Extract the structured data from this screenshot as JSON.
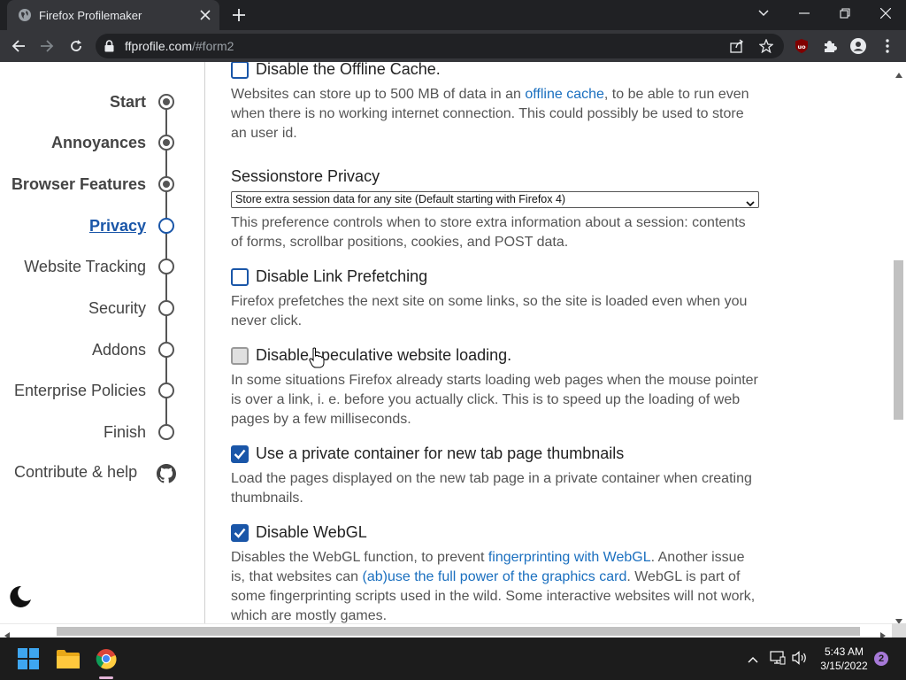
{
  "browser": {
    "tab_title": "Firefox Profilemaker",
    "url_host": "ffprofile.com",
    "url_path": "/#form2"
  },
  "sidebar": {
    "items": [
      {
        "label": "Start",
        "state": "done"
      },
      {
        "label": "Annoyances",
        "state": "done"
      },
      {
        "label": "Browser Features",
        "state": "done"
      },
      {
        "label": "Privacy",
        "state": "active"
      },
      {
        "label": "Website Tracking",
        "state": "todo"
      },
      {
        "label": "Security",
        "state": "todo"
      },
      {
        "label": "Addons",
        "state": "todo"
      },
      {
        "label": "Enterprise Policies",
        "state": "todo"
      },
      {
        "label": "Finish",
        "state": "todo"
      }
    ],
    "contribute_label": "Contribute & help"
  },
  "content": {
    "offline_cache": {
      "label": "Disable the Offline Cache.",
      "checked": false,
      "desc_before": "Websites can store up to 500 MB of data in an ",
      "desc_link": "offline cache",
      "desc_after": ", to be able to run even when there is no working internet connection. This could possibly be used to store an user id."
    },
    "sessionstore": {
      "title": "Sessionstore Privacy",
      "selected": "Store extra session data for any site (Default starting with Firefox 4)",
      "desc": "This preference controls when to store extra information about a session: contents of forms, scrollbar positions, cookies, and POST data."
    },
    "link_prefetch": {
      "label": "Disable Link Prefetching",
      "checked": false,
      "desc": "Firefox prefetches the next site on some links, so the site is loaded even when you never click."
    },
    "speculative": {
      "label": "Disable speculative website loading.",
      "checked": false,
      "desc": "In some situations Firefox already starts loading web pages when the mouse pointer is over a link, i. e. before you actually click. This is to speed up the loading of web pages by a few milliseconds."
    },
    "private_container": {
      "label": "Use a private container for new tab page thumbnails",
      "checked": true,
      "desc": "Load the pages displayed on the new tab page in a private container when creating thumbnails."
    },
    "webgl": {
      "label": "Disable WebGL",
      "checked": true,
      "desc_a": "Disables the WebGL function, to prevent ",
      "desc_link1": "fingerprinting with WebGL",
      "desc_b": ". Another issue is, that websites can ",
      "desc_link2": "(ab)use the full power of the graphics card",
      "desc_c": ". WebGL is part of some fingerprinting scripts used in the wild. Some interactive websites will not work, which are mostly games."
    }
  },
  "taskbar": {
    "time": "5:43 AM",
    "date": "3/15/2022",
    "notification_count": "2"
  },
  "colors": {
    "accent": "#1a56a8",
    "link": "#1a6fbf",
    "chrome_dark": "#202124",
    "chrome_toolbar": "#35363a"
  }
}
